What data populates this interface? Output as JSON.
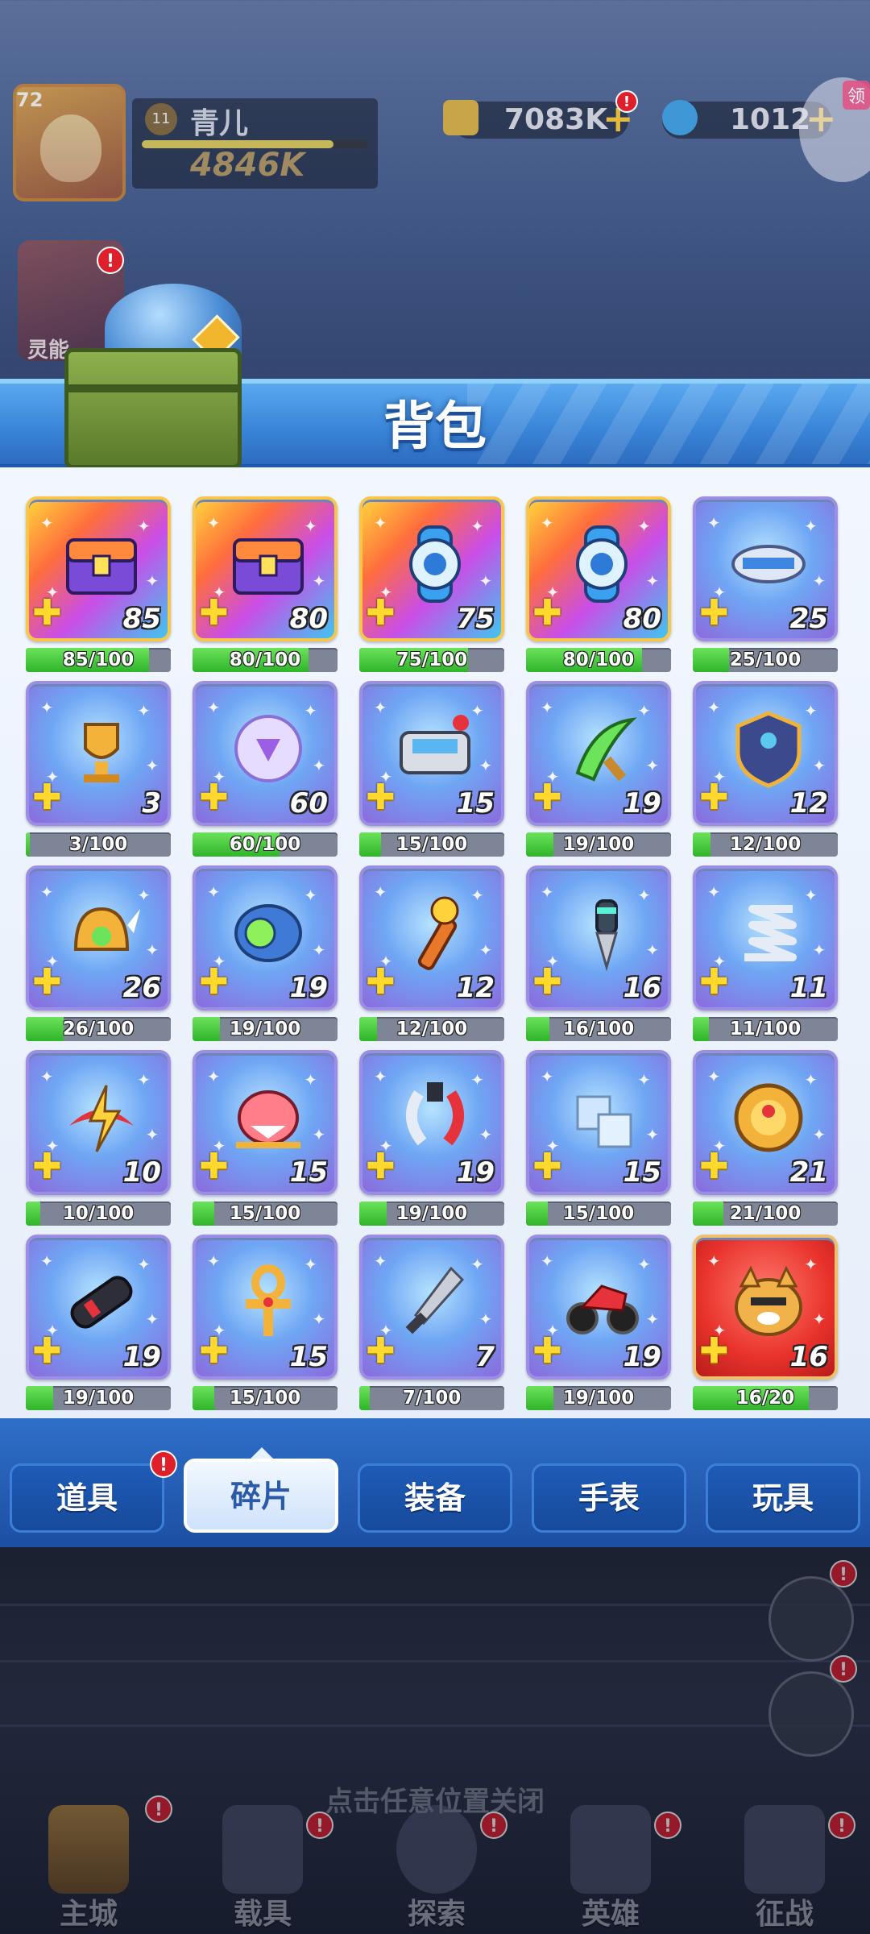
{
  "hud": {
    "level": "72",
    "vip": "11",
    "name": "青儿",
    "power": "4846K",
    "cash": "7083K",
    "gems": "1012",
    "gift_label": "领",
    "side_hero_label": "灵能"
  },
  "panel": {
    "title": "背包"
  },
  "items": [
    {
      "name": "彩虹宝箱A",
      "count": "85",
      "progress": "85/100",
      "fraction": 0.85,
      "style": "rainbow",
      "icon": "chest-icon"
    },
    {
      "name": "彩虹宝箱B",
      "count": "80",
      "progress": "80/100",
      "fraction": 0.8,
      "style": "rainbow",
      "icon": "chest-icon"
    },
    {
      "name": "蓝色手表",
      "count": "75",
      "progress": "75/100",
      "fraction": 0.75,
      "style": "rainbow",
      "icon": "watch-icon"
    },
    {
      "name": "螺旋手表",
      "count": "80",
      "progress": "80/100",
      "fraction": 0.8,
      "style": "rainbow",
      "icon": "watch-icon"
    },
    {
      "name": "机甲飞艇",
      "count": "25",
      "progress": "25/100",
      "fraction": 0.25,
      "style": "purple",
      "icon": "ship-icon"
    },
    {
      "name": "金色奖杯",
      "count": "3",
      "progress": "3/100",
      "fraction": 0.03,
      "style": "purple",
      "icon": "trophy-icon"
    },
    {
      "name": "能量水晶球",
      "count": "60",
      "progress": "60/100",
      "fraction": 0.6,
      "style": "purple",
      "icon": "orb-icon"
    },
    {
      "name": "控制台",
      "count": "15",
      "progress": "15/100",
      "fraction": 0.15,
      "style": "purple",
      "icon": "console-icon"
    },
    {
      "name": "绿刃",
      "count": "19",
      "progress": "19/100",
      "fraction": 0.19,
      "style": "purple",
      "icon": "blade-icon"
    },
    {
      "name": "护盾",
      "count": "12",
      "progress": "12/100",
      "fraction": 0.12,
      "style": "purple",
      "icon": "shield-icon"
    },
    {
      "name": "金翼头盔",
      "count": "26",
      "progress": "26/100",
      "fraction": 0.26,
      "style": "purple",
      "icon": "helmet-icon"
    },
    {
      "name": "机械眼球",
      "count": "19",
      "progress": "19/100",
      "fraction": 0.19,
      "style": "purple",
      "icon": "eye-icon"
    },
    {
      "name": "火焰火炬",
      "count": "12",
      "progress": "12/100",
      "fraction": 0.12,
      "style": "purple",
      "icon": "torch-icon"
    },
    {
      "name": "钻头",
      "count": "16",
      "progress": "16/100",
      "fraction": 0.16,
      "style": "purple",
      "icon": "drill-icon"
    },
    {
      "name": "银色弹簧",
      "count": "11",
      "progress": "11/100",
      "fraction": 0.11,
      "style": "purple",
      "icon": "spring-icon"
    },
    {
      "name": "雷电徽章",
      "count": "10",
      "progress": "10/100",
      "fraction": 0.1,
      "style": "purple",
      "icon": "lightning-icon"
    },
    {
      "name": "鲨鱼玩偶",
      "count": "15",
      "progress": "15/100",
      "fraction": 0.15,
      "style": "purple",
      "icon": "shark-icon"
    },
    {
      "name": "机械爪",
      "count": "19",
      "progress": "19/100",
      "fraction": 0.19,
      "style": "purple",
      "icon": "claw-icon"
    },
    {
      "name": "冰晶方块",
      "count": "15",
      "progress": "15/100",
      "fraction": 0.15,
      "style": "purple",
      "icon": "cube-icon"
    },
    {
      "name": "金色罗盘",
      "count": "21",
      "progress": "21/100",
      "fraction": 0.21,
      "style": "purple",
      "icon": "compass-icon"
    },
    {
      "name": "火箭炮",
      "count": "19",
      "progress": "19/100",
      "fraction": 0.19,
      "style": "purple",
      "icon": "cannon-icon"
    },
    {
      "name": "金色钥匙",
      "count": "15",
      "progress": "15/100",
      "fraction": 0.15,
      "style": "purple",
      "icon": "ankh-icon"
    },
    {
      "name": "战斗匕首",
      "count": "7",
      "progress": "7/100",
      "fraction": 0.07,
      "style": "purple",
      "icon": "dagger-icon"
    },
    {
      "name": "摩托车",
      "count": "19",
      "progress": "19/100",
      "fraction": 0.19,
      "style": "purple",
      "icon": "motorbike-icon"
    },
    {
      "name": "柴犬",
      "count": "16",
      "progress": "16/20",
      "fraction": 0.8,
      "style": "red",
      "icon": "dog-icon"
    }
  ],
  "tabs": [
    {
      "label": "道具",
      "active": false,
      "badge": "!"
    },
    {
      "label": "碎片",
      "active": true
    },
    {
      "label": "装备",
      "active": false
    },
    {
      "label": "手表",
      "active": false
    },
    {
      "label": "玩具",
      "active": false
    }
  ],
  "close_hint": "点击任意位置关闭",
  "nav": [
    {
      "label": "主城",
      "badge": "!"
    },
    {
      "label": "载具",
      "badge": "!"
    },
    {
      "label": "探索",
      "badge": "!"
    },
    {
      "label": "英雄",
      "badge": "!"
    },
    {
      "label": "征战",
      "badge": "!"
    }
  ],
  "colors": {
    "accent": "#3b86d9",
    "progress_fill": "#2fb42a",
    "badge": "#e01f2c",
    "tab_bg": "#1e5bb8"
  }
}
